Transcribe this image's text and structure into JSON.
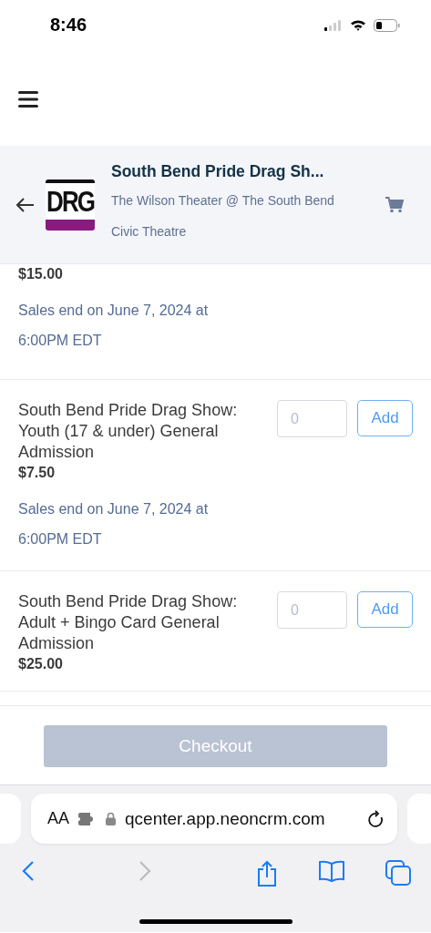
{
  "status_bar": {
    "time": "8:46"
  },
  "event": {
    "title": "South Bend Pride Drag Sh...",
    "venue": "The Wilson Theater @ The South Bend Civic Theatre",
    "logo_text": "DRG"
  },
  "tickets": [
    {
      "price": "$15.00",
      "sales_end": "Sales end on June 7, 2024 at 6:00PM EDT"
    },
    {
      "name": "South Bend Pride Drag Show: Youth (17 & under) General Admission",
      "quantity_placeholder": "0",
      "button": "Add",
      "price": "$7.50",
      "sales_end": "Sales end on June 7, 2024 at 6:00PM EDT"
    },
    {
      "name": "South Bend Pride Drag Show: Adult + Bingo Card General Admission",
      "quantity_placeholder": "0",
      "button": "Add",
      "price": "$25.00"
    }
  ],
  "checkout": {
    "label": "Checkout",
    "disabled": true
  },
  "browser": {
    "text_size": "AA",
    "url": "qcenter.app.neoncrm.com"
  }
}
